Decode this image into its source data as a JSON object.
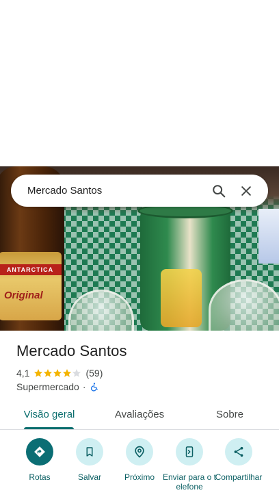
{
  "search": {
    "query": "Mercado Santos"
  },
  "photo": {
    "bottle_band": "ANTARCTICA",
    "bottle_brand": "Original"
  },
  "place": {
    "name": "Mercado Santos",
    "rating": "4,1",
    "stars_value": 4.1,
    "reviews_count": "(59)",
    "category": "Supermercado",
    "separator": "·"
  },
  "tabs": [
    {
      "label": "Visão geral",
      "active": true
    },
    {
      "label": "Avaliações",
      "active": false
    },
    {
      "label": "Sobre",
      "active": false
    }
  ],
  "actions": [
    {
      "label": "Rotas",
      "icon": "directions-icon"
    },
    {
      "label": "Salvar",
      "icon": "bookmark-icon"
    },
    {
      "label": "Próximo",
      "icon": "nearby-icon"
    },
    {
      "label": "Enviar para o telefone",
      "icon": "send-to-phone-icon"
    },
    {
      "label": "Compartilhar",
      "icon": "share-icon"
    }
  ],
  "colors": {
    "accent": "#0b6e74",
    "accent_light": "#cfeff2",
    "star": "#f4b400"
  }
}
